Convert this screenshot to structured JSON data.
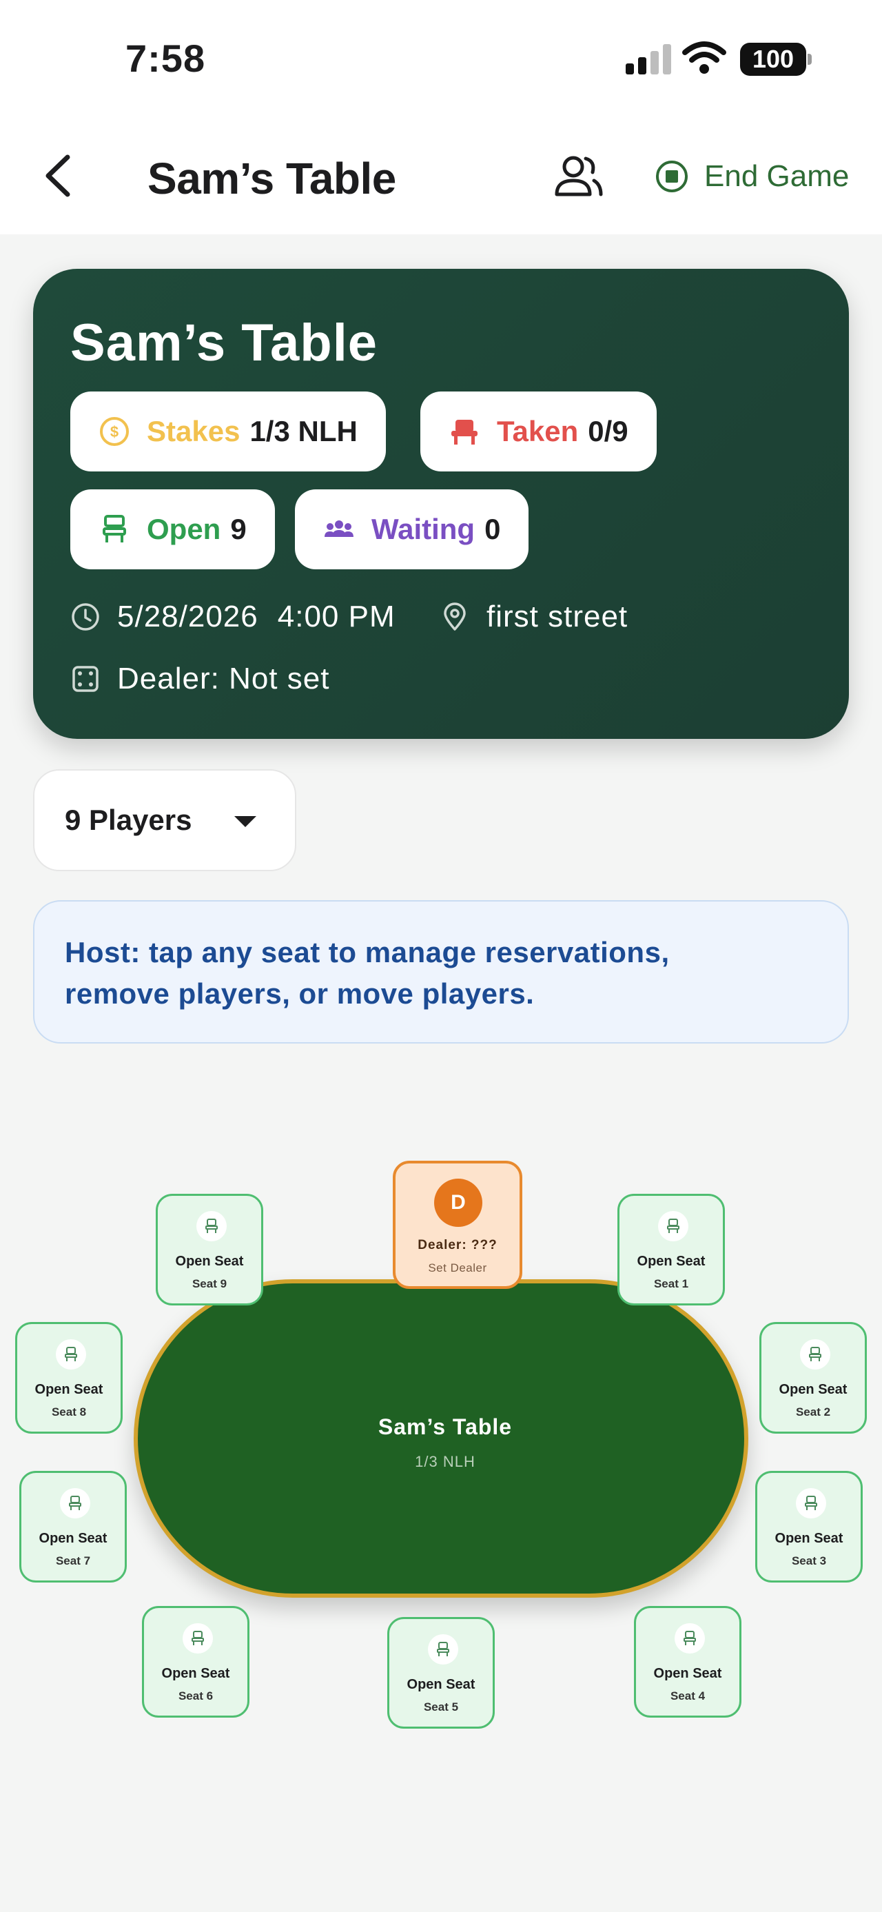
{
  "status_bar": {
    "time": "7:58",
    "battery": "100"
  },
  "nav": {
    "title": "Sam’s Table",
    "end_game_label": "End Game",
    "icons": {
      "back": "chevron-left-icon",
      "players": "people-icon",
      "end": "stop-circle-icon"
    }
  },
  "hero": {
    "title": "Sam’s Table",
    "chips": {
      "stakes": {
        "key": "Stakes",
        "value": "1/3 NLH",
        "color": "#f2c14e"
      },
      "taken": {
        "key": "Taken",
        "value": "0/9",
        "color": "#e2504c"
      },
      "open": {
        "key": "Open",
        "value": "9",
        "color": "#2e9e4f"
      },
      "waiting": {
        "key": "Waiting",
        "value": "0",
        "color": "#7a4fc2"
      }
    },
    "date": "5/28/2026",
    "time": "4:00 PM",
    "location": "first street",
    "dealer": "Dealer: Not set"
  },
  "players_select": {
    "value": "9 Players"
  },
  "info_banner": {
    "line1": "Host: tap any seat to manage reservations,",
    "line2": "remove players, or move players."
  },
  "table": {
    "name": "Sam’s Table",
    "stakes": "1/3 NLH",
    "dealer": {
      "badge": "D",
      "label": "Dealer: ???",
      "action": "Set Dealer"
    },
    "seats": [
      {
        "status": "Open Seat",
        "label": "Seat 1"
      },
      {
        "status": "Open Seat",
        "label": "Seat 2"
      },
      {
        "status": "Open Seat",
        "label": "Seat 3"
      },
      {
        "status": "Open Seat",
        "label": "Seat 4"
      },
      {
        "status": "Open Seat",
        "label": "Seat 5"
      },
      {
        "status": "Open Seat",
        "label": "Seat 6"
      },
      {
        "status": "Open Seat",
        "label": "Seat 7"
      },
      {
        "status": "Open Seat",
        "label": "Seat 8"
      },
      {
        "status": "Open Seat",
        "label": "Seat 9"
      }
    ]
  },
  "colors": {
    "felt": "#1f6123",
    "rail": "#d2a22c",
    "seat_border": "#4fbe71",
    "accent_green": "#2e6b35",
    "dealer_orange": "#e5761c"
  }
}
